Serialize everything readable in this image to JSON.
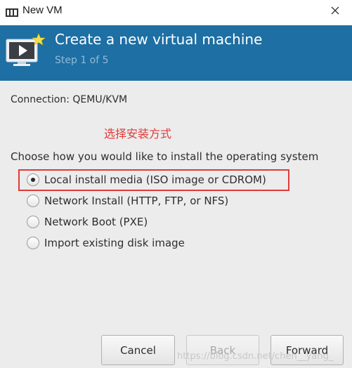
{
  "window": {
    "title": "New VM",
    "icon": "vm-manager-icon",
    "close_icon": "close-icon"
  },
  "header": {
    "title": "Create a new virtual machine",
    "step": "Step 1 of 5",
    "icon": "monitor-play-icon",
    "background": "#1e6fa3"
  },
  "connection": {
    "label": "Connection:",
    "value": "QEMU/KVM"
  },
  "annotation": {
    "text": "选择安装方式",
    "color": "#e03a3a"
  },
  "install": {
    "prompt": "Choose how you would like to install the operating system",
    "options": [
      {
        "label": "Local install media (ISO image or CDROM)",
        "selected": true
      },
      {
        "label": "Network Install (HTTP, FTP, or NFS)",
        "selected": false
      },
      {
        "label": "Network Boot (PXE)",
        "selected": false
      },
      {
        "label": "Import existing disk image",
        "selected": false
      }
    ]
  },
  "buttons": {
    "cancel": "Cancel",
    "back": "Back",
    "forward": "Forward"
  },
  "watermark": "https://blog.csdn.net/chen__yang_"
}
